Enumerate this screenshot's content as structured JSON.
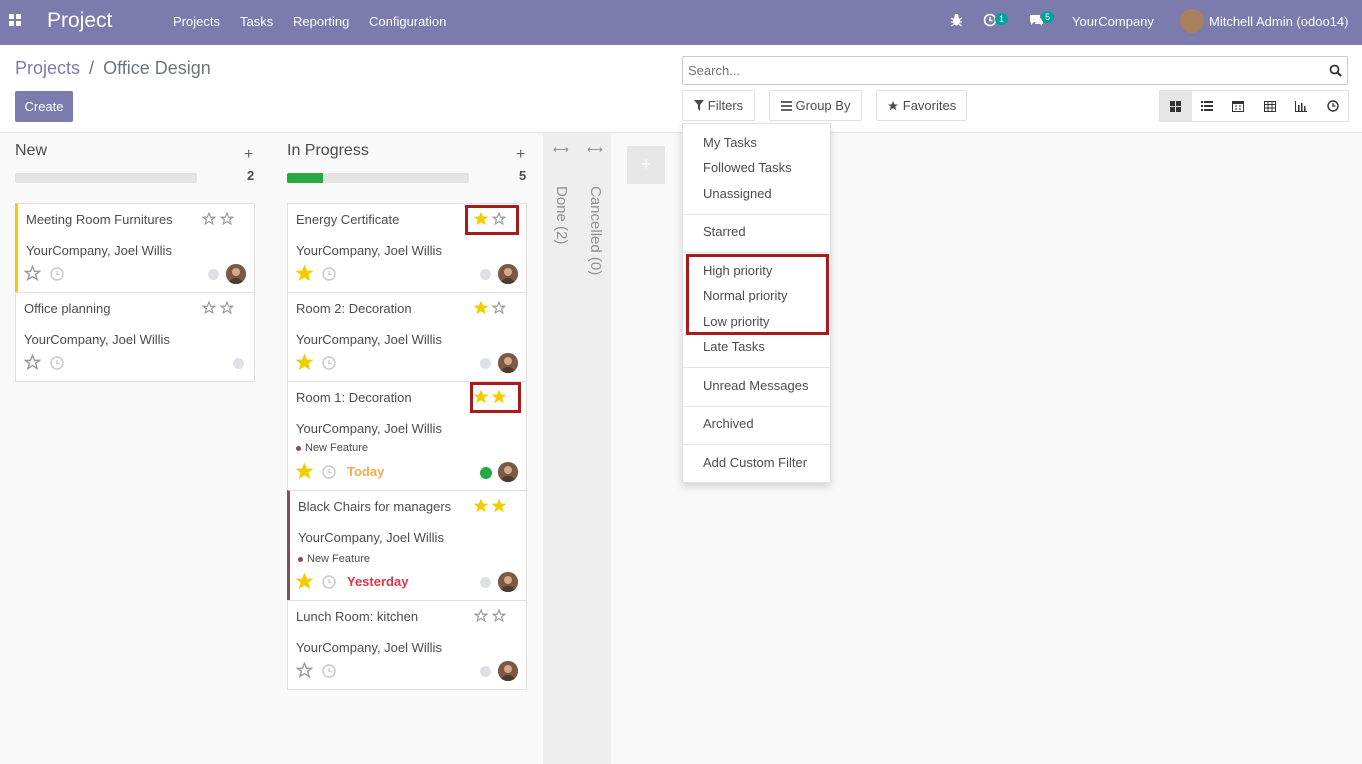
{
  "navbar": {
    "app_name": "Project",
    "menu": [
      "Projects",
      "Tasks",
      "Reporting",
      "Configuration"
    ],
    "activity_count": "1",
    "message_count": "5",
    "company": "YourCompany",
    "user": "Mitchell Admin (odoo14)",
    "apps_icon": "grid-icon",
    "debug_icon": "bug-icon"
  },
  "breadcrumb": {
    "parent": "Projects",
    "separator": "/",
    "current": "Office Design"
  },
  "search": {
    "placeholder": "Search..."
  },
  "buttons": {
    "create": "Create",
    "filters": "Filters",
    "group_by": "Group By",
    "favorites": "Favorites"
  },
  "views": [
    "kanban-icon",
    "list-icon",
    "calendar-icon",
    "pivot-icon",
    "graph-icon",
    "activity-icon"
  ],
  "columns": [
    {
      "title": "New",
      "count": "2",
      "progress": 0
    },
    {
      "title": "In Progress",
      "count": "5",
      "progress": 0.2
    },
    {
      "title": "Done (2)"
    },
    {
      "title": "Cancelled (0)"
    }
  ],
  "cards_new": [
    {
      "name": "Meeting Room Furnitures",
      "customer": "YourCompany, Joel Willis",
      "priority": 0
    },
    {
      "name": "Office planning",
      "customer": "YourCompany, Joel Willis",
      "priority": 0
    }
  ],
  "cards_progress": [
    {
      "name": "Energy Certificate",
      "customer": "YourCompany, Joel Willis",
      "priority": 1
    },
    {
      "name": "Room 2: Decoration",
      "customer": "YourCompany, Joel Willis",
      "priority": 1
    },
    {
      "name": "Room 1: Decoration",
      "customer": "YourCompany, Joel Willis",
      "priority": 2,
      "tag": "New Feature",
      "deadline": "Today"
    },
    {
      "name": "Black Chairs for managers",
      "customer": "YourCompany, Joel Willis",
      "priority": 2,
      "tag": "New Feature",
      "deadline": "Yesterday"
    },
    {
      "name": "Lunch Room: kitchen",
      "customer": "YourCompany, Joel Willis",
      "priority": 0
    }
  ],
  "filters_menu": {
    "items": [
      "My Tasks",
      "Followed Tasks",
      "Unassigned",
      "Starred",
      "High priority",
      "Normal priority",
      "Low priority",
      "Late Tasks",
      "Unread Messages",
      "Archived",
      "Add Custom Filter"
    ]
  },
  "colors": {
    "navbar": "#7c7bad",
    "primary": "#7c7bad",
    "star": "#f3cc00",
    "today": "#f0ad4e",
    "overdue": "#dc3545",
    "highlight": "#a61b1b",
    "progress": "#28a745"
  }
}
